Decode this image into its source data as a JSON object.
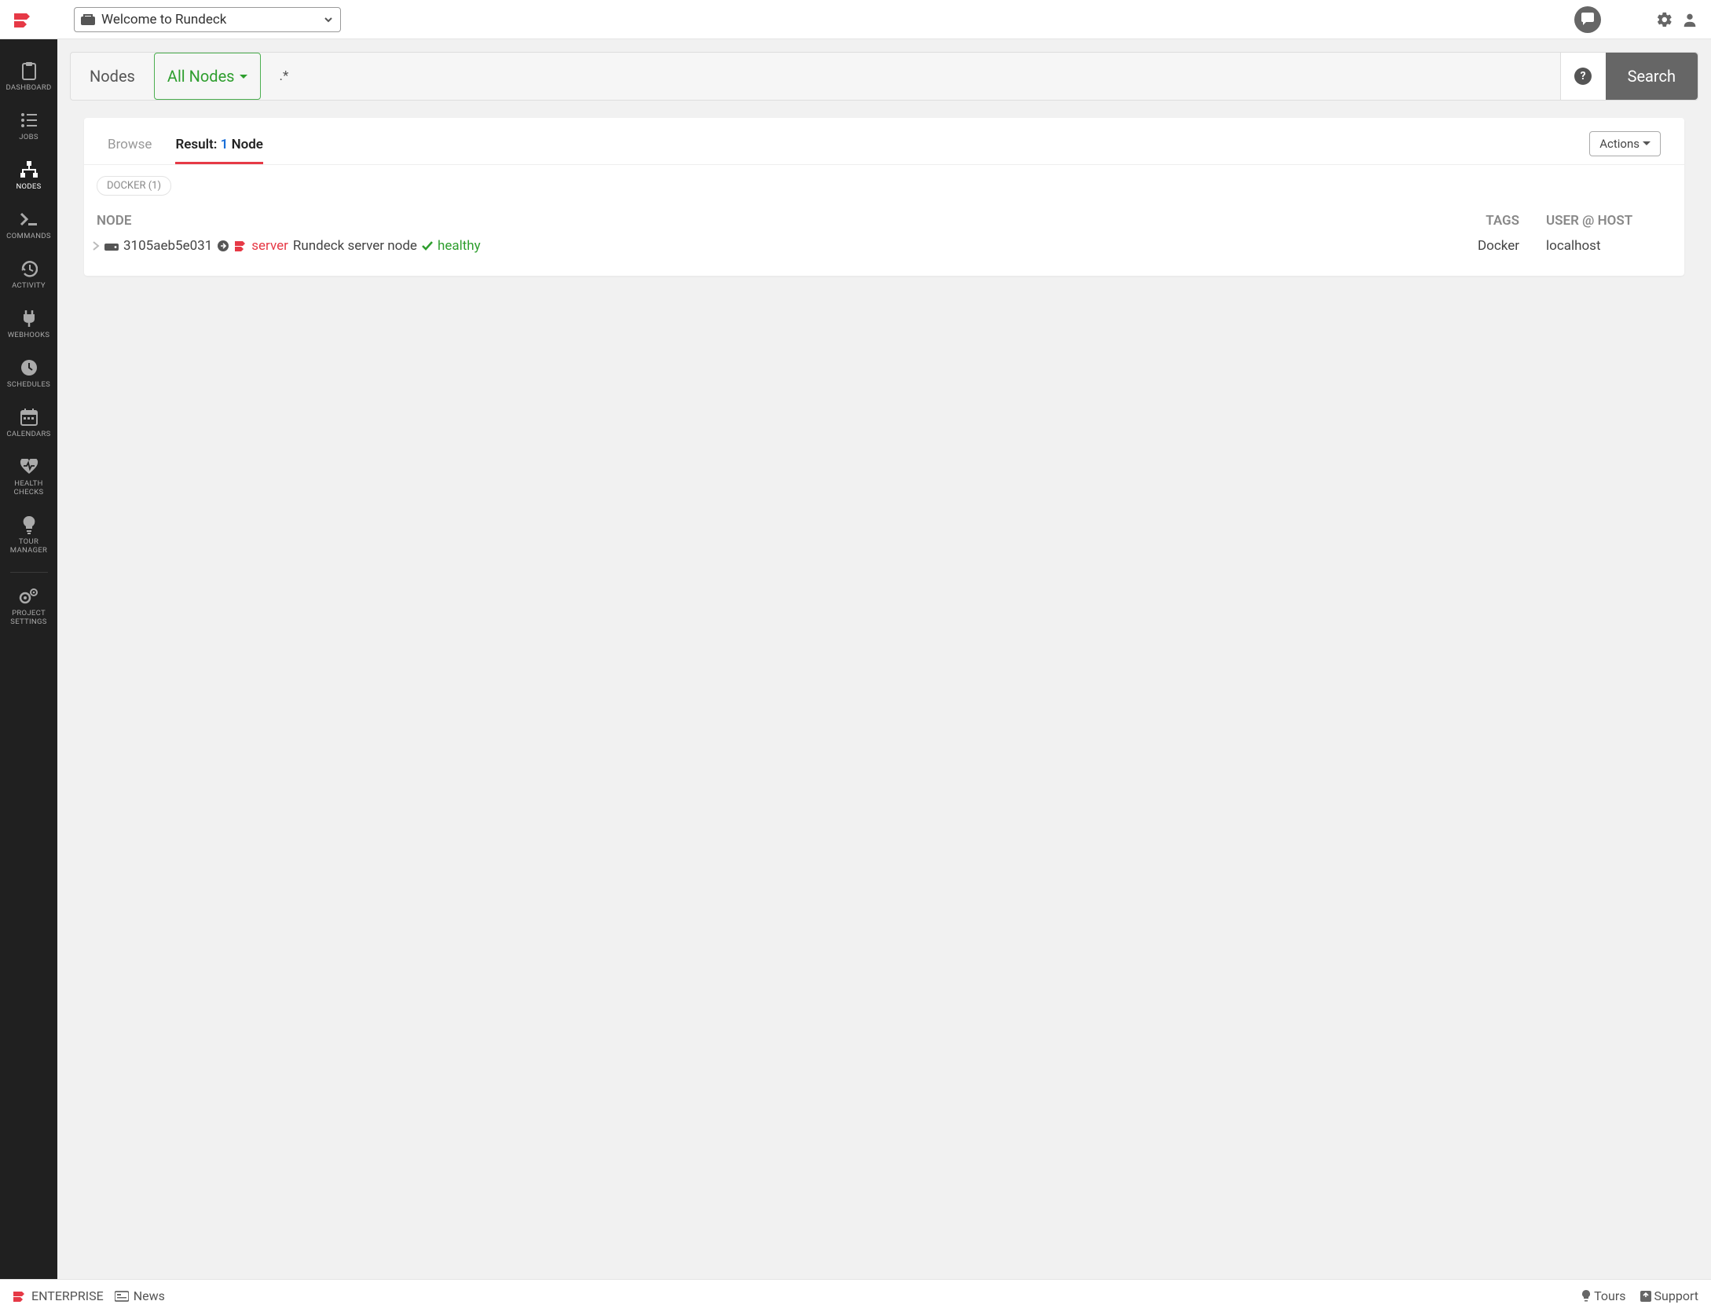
{
  "topbar": {
    "project_label": "Welcome to Rundeck"
  },
  "sidebar": {
    "items": [
      {
        "label": "DASHBOARD"
      },
      {
        "label": "JOBS"
      },
      {
        "label": "NODES"
      },
      {
        "label": "COMMANDS"
      },
      {
        "label": "ACTIVITY"
      },
      {
        "label": "WEBHOOKS"
      },
      {
        "label": "SCHEDULES"
      },
      {
        "label": "CALENDARS"
      },
      {
        "label": "HEALTH CHECKS"
      },
      {
        "label": "TOUR MANAGER"
      },
      {
        "label": "PROJECT SETTINGS"
      }
    ],
    "active_index": 2
  },
  "filterbar": {
    "label": "Nodes",
    "filter_name": "All Nodes",
    "query": ".*",
    "search_label": "Search"
  },
  "results": {
    "tabs": {
      "browse": "Browse",
      "result_prefix": "Result:",
      "result_count": "1",
      "result_suffix": "Node"
    },
    "actions_label": "Actions",
    "chip": "DOCKER (1)",
    "headers": {
      "node": "NODE",
      "tags": "TAGS",
      "userhost": "USER @ HOST"
    },
    "row": {
      "name": "3105aeb5e031",
      "server_label": "server",
      "description": "Rundeck server node",
      "health": "healthy",
      "tags": "Docker",
      "userhost": "localhost"
    }
  },
  "footer": {
    "enterprise": "ENTERPRISE",
    "news": "News",
    "tours": "Tours",
    "support": "Support"
  }
}
